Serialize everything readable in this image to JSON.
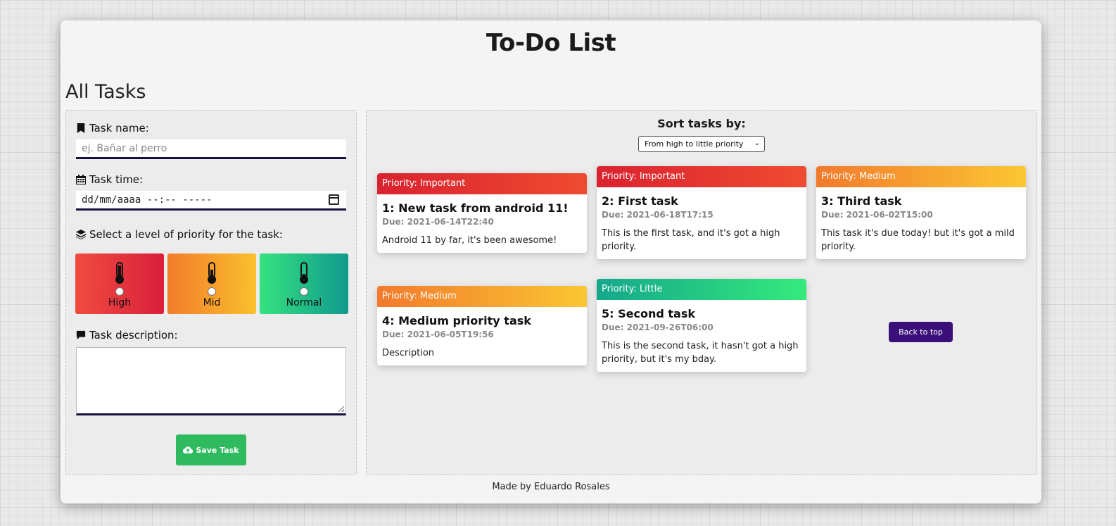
{
  "app": {
    "title": "To-Do List",
    "section_title": "All Tasks",
    "footer": "Made by Eduardo Rosales"
  },
  "form": {
    "task_name_label": "Task name:",
    "task_name_placeholder": "ej. Bañar al perro",
    "task_time_label": "Task time:",
    "task_time_value": "dd/mm/aaaa --:-- -----",
    "priority_label": "Select a level of priority for the task:",
    "priorities": [
      {
        "label": "High",
        "color": "#e3353c"
      },
      {
        "label": "Mid",
        "color": "#f7a02f"
      },
      {
        "label": "Normal",
        "color": "#24c486"
      }
    ],
    "description_label": "Task description:",
    "save_label": "Save Task"
  },
  "tasks": {
    "sort_label": "Sort tasks by:",
    "sort_value": "From high to little priority",
    "back_to_top": "Back to top",
    "cards": [
      {
        "priority": "Priority: Important",
        "title": "1: New task from android 11!",
        "due": "Due: 2021-06-14T22:40",
        "desc": "Android 11 by far, it's been awesome!"
      },
      {
        "priority": "Priority: Important",
        "title": "2: First task",
        "due": "Due: 2021-06-18T17:15",
        "desc": "This is the first task, and it's got a high priority."
      },
      {
        "priority": "Priority: Medium",
        "title": "3: Third task",
        "due": "Due: 2021-06-02T15:00",
        "desc": "This task it's due today! but it's got a mild priority."
      },
      {
        "priority": "Priority: Medium",
        "title": "4: Medium priority task",
        "due": "Due: 2021-06-05T19:56",
        "desc": "Description"
      },
      {
        "priority": "Priority: Little",
        "title": "5: Second task",
        "due": "Due: 2021-09-26T06:00",
        "desc": "This is the second task, it hasn't got a high priority, but it's my bday."
      }
    ]
  }
}
